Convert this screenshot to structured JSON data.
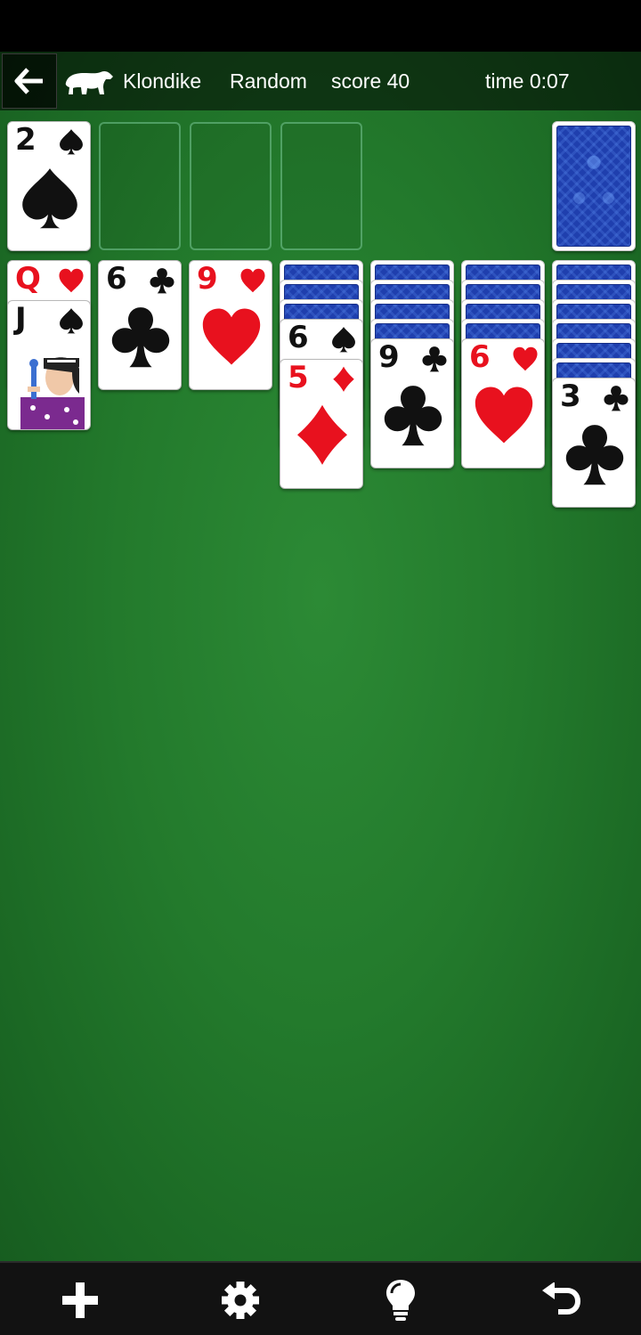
{
  "header": {
    "game_name": "Klondike",
    "mode": "Random",
    "score_label": "score 40",
    "time_label": "time 0:07"
  },
  "icons": {
    "back": "arrow-left-icon",
    "logo": "polar-bear-icon",
    "new_game": "plus-icon",
    "settings": "gear-icon",
    "hint": "lightbulb-icon",
    "undo": "undo-icon"
  },
  "colors": {
    "felt": "#237a2c",
    "red_suit": "#e8111e",
    "card_back": "#1f3fae"
  },
  "foundations": [
    {
      "rank": "2",
      "suit": "spade"
    },
    {
      "rank": "",
      "suit": ""
    },
    {
      "rank": "",
      "suit": ""
    },
    {
      "rank": "",
      "suit": ""
    }
  ],
  "stock": {
    "face_down": true
  },
  "tableau": [
    {
      "hidden": 0,
      "cards": [
        {
          "rank": "Q",
          "suit": "heart"
        },
        {
          "rank": "J",
          "suit": "spade"
        }
      ]
    },
    {
      "hidden": 0,
      "cards": [
        {
          "rank": "6",
          "suit": "club"
        }
      ]
    },
    {
      "hidden": 0,
      "cards": [
        {
          "rank": "9",
          "suit": "heart"
        }
      ]
    },
    {
      "hidden": 3,
      "cards": [
        {
          "rank": "6",
          "suit": "spade"
        },
        {
          "rank": "5",
          "suit": "diamond"
        }
      ]
    },
    {
      "hidden": 4,
      "cards": [
        {
          "rank": "9",
          "suit": "club"
        }
      ]
    },
    {
      "hidden": 4,
      "cards": [
        {
          "rank": "6",
          "suit": "heart"
        }
      ]
    },
    {
      "hidden": 6,
      "cards": [
        {
          "rank": "3",
          "suit": "club"
        }
      ]
    }
  ]
}
